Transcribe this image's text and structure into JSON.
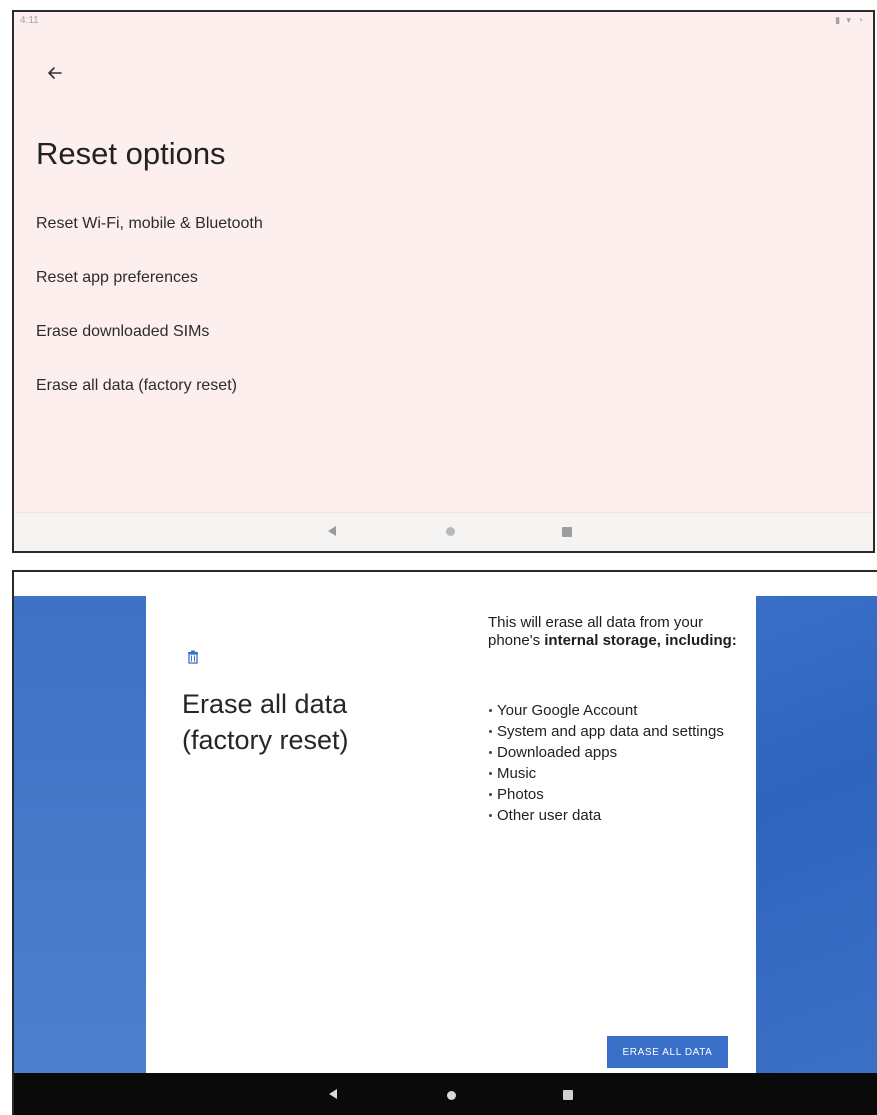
{
  "reset_options_screen": {
    "status_bar": {
      "time": "4:11",
      "icons": "▮ ▾ ◔"
    },
    "back_icon": "arrow-left",
    "title": "Reset options",
    "options": [
      {
        "label": "Reset Wi-Fi, mobile & Bluetooth"
      },
      {
        "label": "Reset app preferences"
      },
      {
        "label": "Erase downloaded SIMs"
      },
      {
        "label": "Erase all data (factory reset)"
      }
    ],
    "navbar": {
      "back": "nav-back",
      "home": "nav-home",
      "recents": "nav-recents"
    }
  },
  "erase_all_data_screen": {
    "icon": "trash",
    "title_line1": "Erase all data",
    "title_line2": "(factory reset)",
    "description_prefix": "This will erase all data from your phone's ",
    "description_bold": "internal storage",
    "description_suffix": ", including:",
    "items": [
      "Your Google Account",
      "System and app data and settings",
      "Downloaded apps",
      "Music",
      "Photos",
      "Other user data"
    ],
    "button_label": "ERASE ALL DATA",
    "colors": {
      "accent": "#3a6fc9",
      "side_panel": "#3f72c4"
    }
  }
}
